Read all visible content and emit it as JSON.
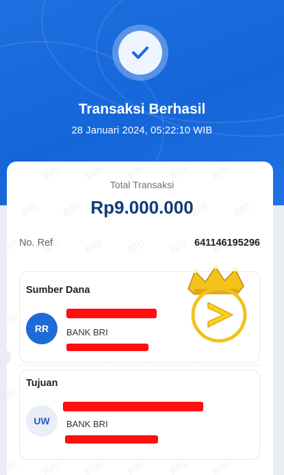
{
  "header": {
    "status_title": "Transaksi Berhasil",
    "datetime": "28 Januari 2024, 05:22:10 WIB"
  },
  "summary": {
    "total_label": "Total Transaksi",
    "total_amount": "Rp9.000.000",
    "ref_label": "No. Ref",
    "ref_value": "641146195296"
  },
  "source": {
    "label": "Sumber Dana",
    "initials": "RR",
    "bank": "BANK BRI"
  },
  "destination": {
    "label": "Tujuan",
    "initials": "UW",
    "bank": "BANK BRI"
  },
  "watermark_text": "BRI",
  "colors": {
    "header_blue": "#1566d9",
    "amount_navy": "#123a7a",
    "avatar_source_bg": "#1e6bd6",
    "avatar_dest_bg": "#e9eef7",
    "redaction_red": "#ff0f0f",
    "badge_gold": "#f2c21a"
  },
  "icons": {
    "status": "checkmark-icon",
    "overlay_badge": "crown-play-badge-icon"
  }
}
